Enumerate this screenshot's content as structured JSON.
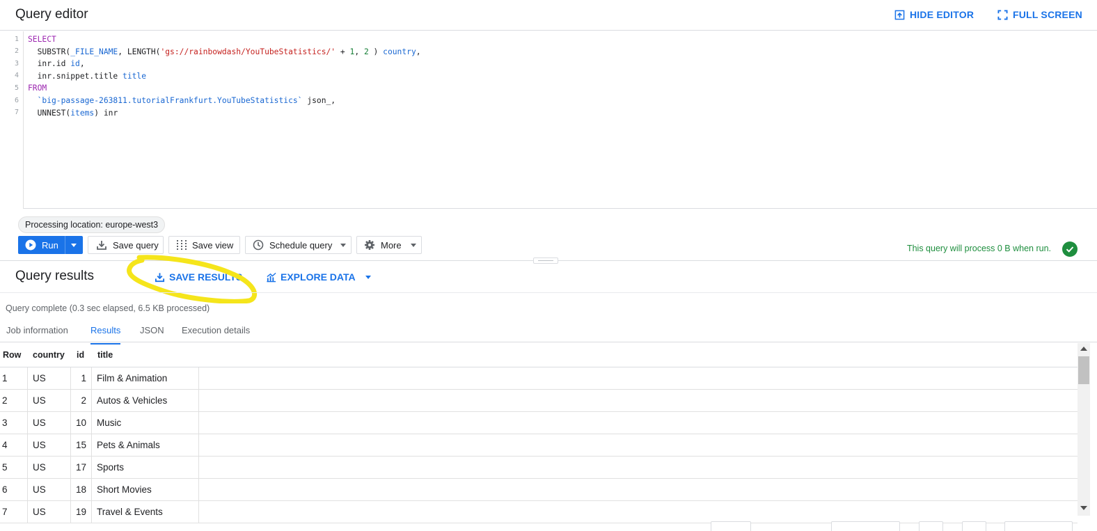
{
  "editor": {
    "title": "Query editor",
    "hide_editor": "HIDE EDITOR",
    "full_screen": "FULL SCREEN",
    "line_numbers": [
      "1",
      "2",
      "3",
      "4",
      "5",
      "6",
      "7"
    ],
    "code": {
      "l1_kw": "SELECT",
      "l2_a": "  SUBSTR(",
      "l2_b": "_FILE_NAME",
      "l2_c": ", LENGTH(",
      "l2_str": "'gs://rainbowdash/YouTubeStatistics/'",
      "l2_d": " + ",
      "l2_n1": "1",
      "l2_e": ", ",
      "l2_n2": "2",
      "l2_f": " ) ",
      "l2_alias": "country",
      "l2_g": ",",
      "l3_a": "  inr.id ",
      "l3_alias": "id",
      "l3_b": ",",
      "l4_a": "  inr.snippet.title ",
      "l4_alias": "title",
      "l5_kw": "FROM",
      "l6_tbl": "  `big-passage-263811.tutorialFrankfurt.YouTubeStatistics`",
      "l6_b": " json_,",
      "l7_a": "  UNNEST(",
      "l7_b": "items",
      "l7_c": ") inr"
    }
  },
  "toolbar": {
    "processing_location": "Processing location: europe-west3",
    "run": "Run",
    "save_query": "Save query",
    "save_view": "Save view",
    "schedule_query": "Schedule query",
    "more": "More",
    "status": "This query will process 0 B when run."
  },
  "results": {
    "title": "Query results",
    "save_results": "SAVE RESULTS",
    "explore_data": "EXPLORE DATA",
    "query_complete": "Query complete (0.3 sec elapsed, 6.5 KB processed)",
    "tabs": [
      "Job information",
      "Results",
      "JSON",
      "Execution details"
    ],
    "active_tab": "Results",
    "columns": [
      "Row",
      "country",
      "id",
      "title"
    ],
    "rows": [
      [
        "1",
        "US",
        "1",
        "Film & Animation"
      ],
      [
        "2",
        "US",
        "2",
        "Autos & Vehicles"
      ],
      [
        "3",
        "US",
        "10",
        "Music"
      ],
      [
        "4",
        "US",
        "15",
        "Pets & Animals"
      ],
      [
        "5",
        "US",
        "17",
        "Sports"
      ],
      [
        "6",
        "US",
        "18",
        "Short Movies"
      ],
      [
        "7",
        "US",
        "19",
        "Travel & Events"
      ]
    ]
  },
  "colors": {
    "accent": "#1a73e8",
    "success": "#1e8e3e",
    "highlight": "#f5e51b"
  }
}
